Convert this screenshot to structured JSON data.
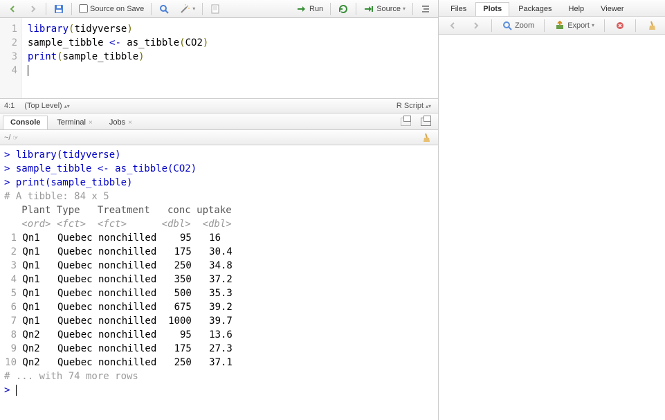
{
  "source_toolbar": {
    "source_on_save": "Source on Save",
    "run": "Run",
    "source_btn": "Source"
  },
  "source_code": {
    "lines": [
      "1",
      "2",
      "3",
      "4"
    ],
    "l1_a": "library",
    "l1_b": "(",
    "l1_c": "tidyverse",
    "l1_d": ")",
    "l2_a": "sample_tibble ",
    "l2_b": "<-",
    "l2_c": " as_tibble",
    "l2_d": "(",
    "l2_e": "CO2",
    "l2_f": ")",
    "l3_a": "print",
    "l3_b": "(",
    "l3_c": "sample_tibble",
    "l3_d": ")"
  },
  "source_status": {
    "pos": "4:1",
    "scope": "(Top Level)",
    "lang": "R Script"
  },
  "console_tabs": {
    "console": "Console",
    "terminal": "Terminal",
    "jobs": "Jobs"
  },
  "console_path": "~/",
  "console": {
    "l1": "> library(tidyverse)",
    "l2": "> sample_tibble <- as_tibble(CO2)",
    "l3": "> print(sample_tibble)",
    "meta": "# A tibble: 84 x 5",
    "header": "   Plant Type   Treatment   conc uptake",
    "types": "   <ord> <fct>  <fct>      <dbl>  <dbl>",
    "rows": [
      {
        "n": "1",
        "plant": "Qn1",
        "type": "Quebec",
        "treat": "nonchilled",
        "conc": "95",
        "uptake": "16"
      },
      {
        "n": "2",
        "plant": "Qn1",
        "type": "Quebec",
        "treat": "nonchilled",
        "conc": "175",
        "uptake": "30.4"
      },
      {
        "n": "3",
        "plant": "Qn1",
        "type": "Quebec",
        "treat": "nonchilled",
        "conc": "250",
        "uptake": "34.8"
      },
      {
        "n": "4",
        "plant": "Qn1",
        "type": "Quebec",
        "treat": "nonchilled",
        "conc": "350",
        "uptake": "37.2"
      },
      {
        "n": "5",
        "plant": "Qn1",
        "type": "Quebec",
        "treat": "nonchilled",
        "conc": "500",
        "uptake": "35.3"
      },
      {
        "n": "6",
        "plant": "Qn1",
        "type": "Quebec",
        "treat": "nonchilled",
        "conc": "675",
        "uptake": "39.2"
      },
      {
        "n": "7",
        "plant": "Qn1",
        "type": "Quebec",
        "treat": "nonchilled",
        "conc": "1000",
        "uptake": "39.7"
      },
      {
        "n": "8",
        "plant": "Qn2",
        "type": "Quebec",
        "treat": "nonchilled",
        "conc": "95",
        "uptake": "13.6"
      },
      {
        "n": "9",
        "plant": "Qn2",
        "type": "Quebec",
        "treat": "nonchilled",
        "conc": "175",
        "uptake": "27.3"
      },
      {
        "n": "10",
        "plant": "Qn2",
        "type": "Quebec",
        "treat": "nonchilled",
        "conc": "250",
        "uptake": "37.1"
      }
    ],
    "more": "# ... with 74 more rows",
    "prompt": "> "
  },
  "right_tabs": {
    "files": "Files",
    "plots": "Plots",
    "packages": "Packages",
    "help": "Help",
    "viewer": "Viewer"
  },
  "right_toolbar": {
    "zoom": "Zoom",
    "export": "Export"
  }
}
